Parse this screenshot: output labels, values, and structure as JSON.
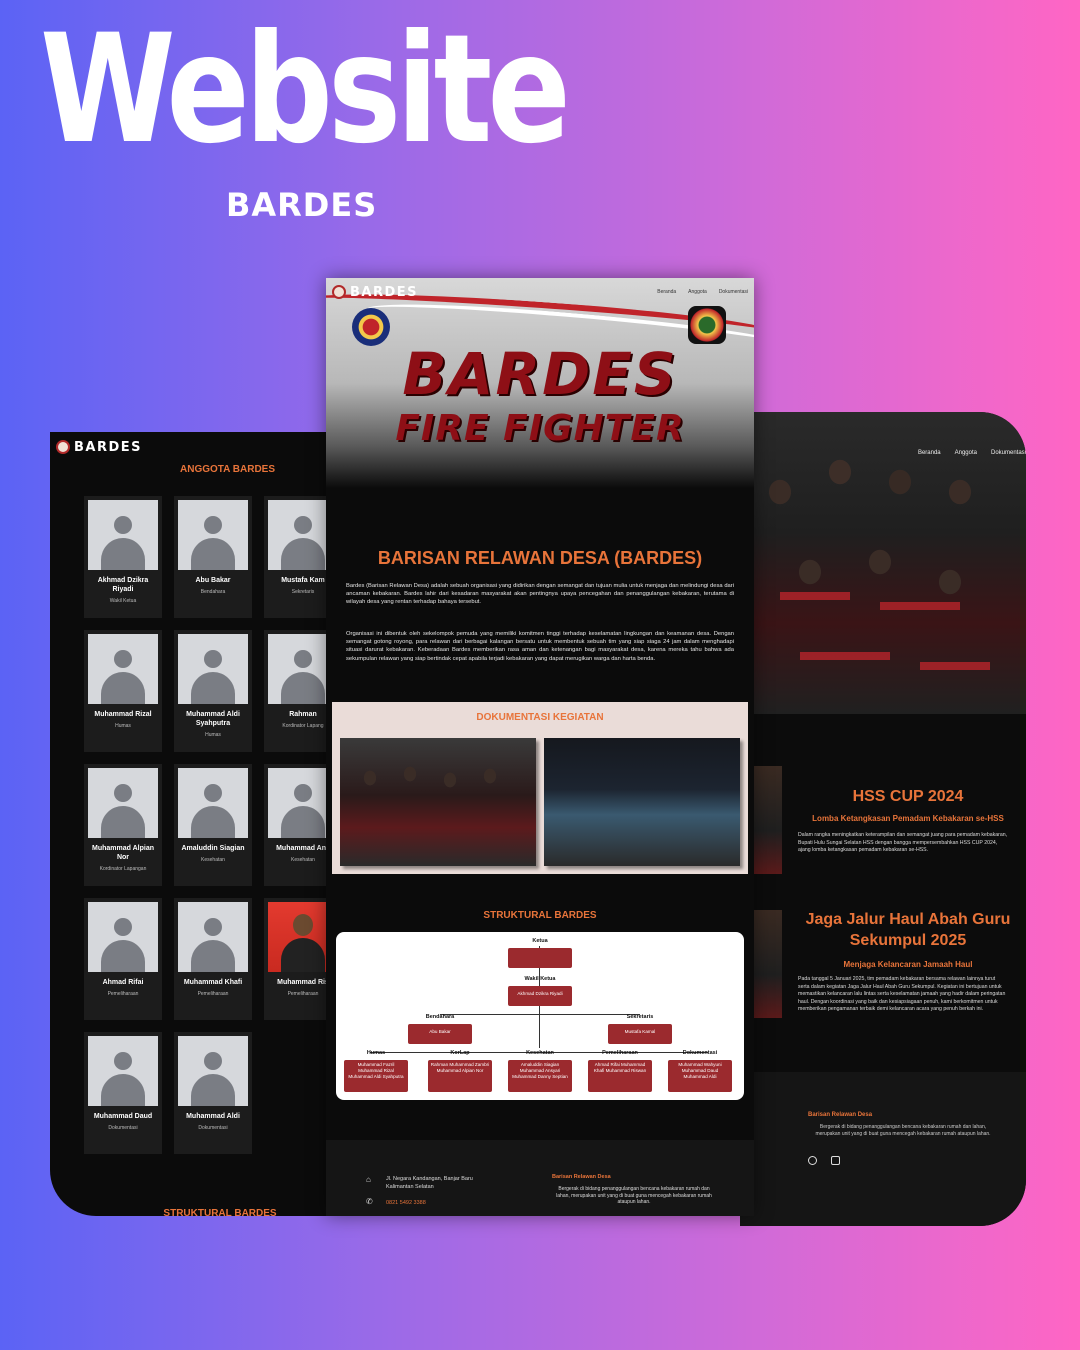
{
  "hero": {
    "title": "Website",
    "subtitle": "BARDES"
  },
  "brand": {
    "logo_text": "BARDES"
  },
  "left": {
    "section_title": "ANGGOTA BARDES",
    "members": [
      {
        "name": "Akhmad Dzikra Riyadi",
        "role": "Wakil Ketua",
        "photo": false
      },
      {
        "name": "Abu Bakar",
        "role": "Bendahara",
        "photo": false
      },
      {
        "name": "Mustafa Kam",
        "role": "Sekretaris",
        "photo": false
      },
      {
        "name": "Muhammad Rizal",
        "role": "Humas",
        "photo": false
      },
      {
        "name": "Muhammad Aldi Syahputra",
        "role": "Humas",
        "photo": false
      },
      {
        "name": "Rahman",
        "role": "Kordinator Lapang",
        "photo": false
      },
      {
        "name": "Muhammad Alpian Nor",
        "role": "Kordinator Lapangan",
        "photo": false
      },
      {
        "name": "Amaluddin Siagian",
        "role": "Kesehatan",
        "photo": false
      },
      {
        "name": "Muhammad Ans",
        "role": "Kesehatan",
        "photo": false
      },
      {
        "name": "Ahmad Rifai",
        "role": "Pemeliharaan",
        "photo": false
      },
      {
        "name": "Muhammad Khafi",
        "role": "Pemeliharaan",
        "photo": false
      },
      {
        "name": "Muhammad Ris",
        "role": "Pemeliharaan",
        "photo": true
      },
      {
        "name": "Muhammad Daud",
        "role": "Dokumentasi",
        "photo": false
      },
      {
        "name": "Muhammad Aldi",
        "role": "Dokumentasi",
        "photo": false
      }
    ],
    "bottom_heading": "STRUKTURAL BARDES"
  },
  "center": {
    "nav": [
      "Beranda",
      "Anggota",
      "Dokumentasi"
    ],
    "banner_line1": "BARDES",
    "banner_line2": "FIRE FIGHTER",
    "about_title": "BARISAN RELAWAN DESA (BARDES)",
    "about_p1": "Bardes (Barisan Relawan Desa) adalah sebuah organisasi yang didirikan dengan semangat dan tujuan mulia untuk menjaga dan melindungi desa dari ancaman kebakaran. Bardes lahir dari kesadaran masyarakat akan pentingnya upaya pencegahan dan penanggulangan kebakaran, terutama di wilayah desa yang rentan terhadap bahaya tersebut.",
    "about_p2": "Organisasi ini dibentuk oleh sekelompok pemuda yang memiliki komitmen tinggi terhadap keselamatan lingkungan dan keamanan desa. Dengan semangat gotong royong, para relawan dari berbagai kalangan bersatu untuk membentuk sebuah tim yang siap siaga 24 jam dalam menghadapi situasi darurat kebakaran. Keberadaan Bardes memberikan rasa aman dan ketenangan bagi masyarakat desa, karena mereka tahu bahwa ada sekumpulan relawan yang siap bertindak cepat apabila terjadi kebakaran yang dapat merugikan warga dan harta benda.",
    "doc_title": "DOKUMENTASI KEGIATAN",
    "struct_title": "STRUKTURAL BARDES",
    "org": {
      "ketua_label": "Ketua",
      "ketua_name": "",
      "wakil_label": "Wakil Ketua",
      "wakil_name": "Akhmad Dzikra Riyadi",
      "bendahara_label": "Bendahara",
      "bendahara_name": "Abu Bakar",
      "sekretaris_label": "Sekretaris",
      "sekretaris_name": "Mustafa Kamal",
      "divisions": [
        {
          "label": "Humas",
          "members": "Muhammad Fazril Muhammad Rizal Muhammad Aldi Syahputra"
        },
        {
          "label": "KorLap",
          "members": "Rahman Muhammad Zambri Muhammad Alpian Nor"
        },
        {
          "label": "Kesehatan",
          "members": "Amaluddin Siagian Muhammad Ansyari Muhammad Danny Septian"
        },
        {
          "label": "Pemeliharaan",
          "members": "Ahmad Rifai Muhammad Khafi Muhammad Riswan"
        },
        {
          "label": "Dokumentasi",
          "members": "Muhammad Wahyuni Muhammad Daud Muhammad Aldi"
        }
      ]
    },
    "footer": {
      "address": "Jl. Negara Kandangan, Banjar Baru Kalimantan Selatan",
      "phone": "0821 5492 3388",
      "org_title": "Barisan Relawan Desa",
      "org_desc": "Bergerak di bidang penanggulangan bencana kebakaran rumah dan lahan, merupakan unit yang di buat guna mencegah kebakaran rumah ataupun lahan."
    }
  },
  "right": {
    "nav": [
      "Beranda",
      "Anggota",
      "Dokumentasi"
    ],
    "events": [
      {
        "title": "HSS CUP 2024",
        "subtitle": "Lomba Ketangkasan Pemadam Kebakaran se-HSS",
        "desc": "Dalam rangka meningkatkan keterampilan dan semangat juang para pemadam kebakaran, Bupati Hulu Sungai Selatan HSS dengan bangga mempersembahkan HSS CUP 2024, ajang lomba ketangkasan pemadam kebakaran se-HSS."
      },
      {
        "title": "Jaga Jalur Haul Abah Guru Sekumpul 2025",
        "subtitle": "Menjaga Kelancaran Jamaah Haul",
        "desc": "Pada tanggal 5 Januari 2025, tim pemadam kebakaran bersama relawan lainnya turut serta dalam kegiatan Jaga Jalur Haul Abah Guru Sekumpul. Kegiatan ini bertujuan untuk memastikan kelancaran lalu lintas serta keselamatan jamaah yang hadir dalam peringatan haul. Dengan koordinasi yang baik dan kesiapsiagaan penuh, kami berkomitmen untuk memberikan pengamanan terbaik demi kelancaran acara yang penuh berkah ini."
      }
    ],
    "footer_title": "Barisan Relawan Desa",
    "footer_desc": "Bergerak di bidang penanggulangan bencana kebakaran rumah dan lahan, merupakan unit yang di buat guna mencegah kebakaran rumah ataupun lahan."
  }
}
